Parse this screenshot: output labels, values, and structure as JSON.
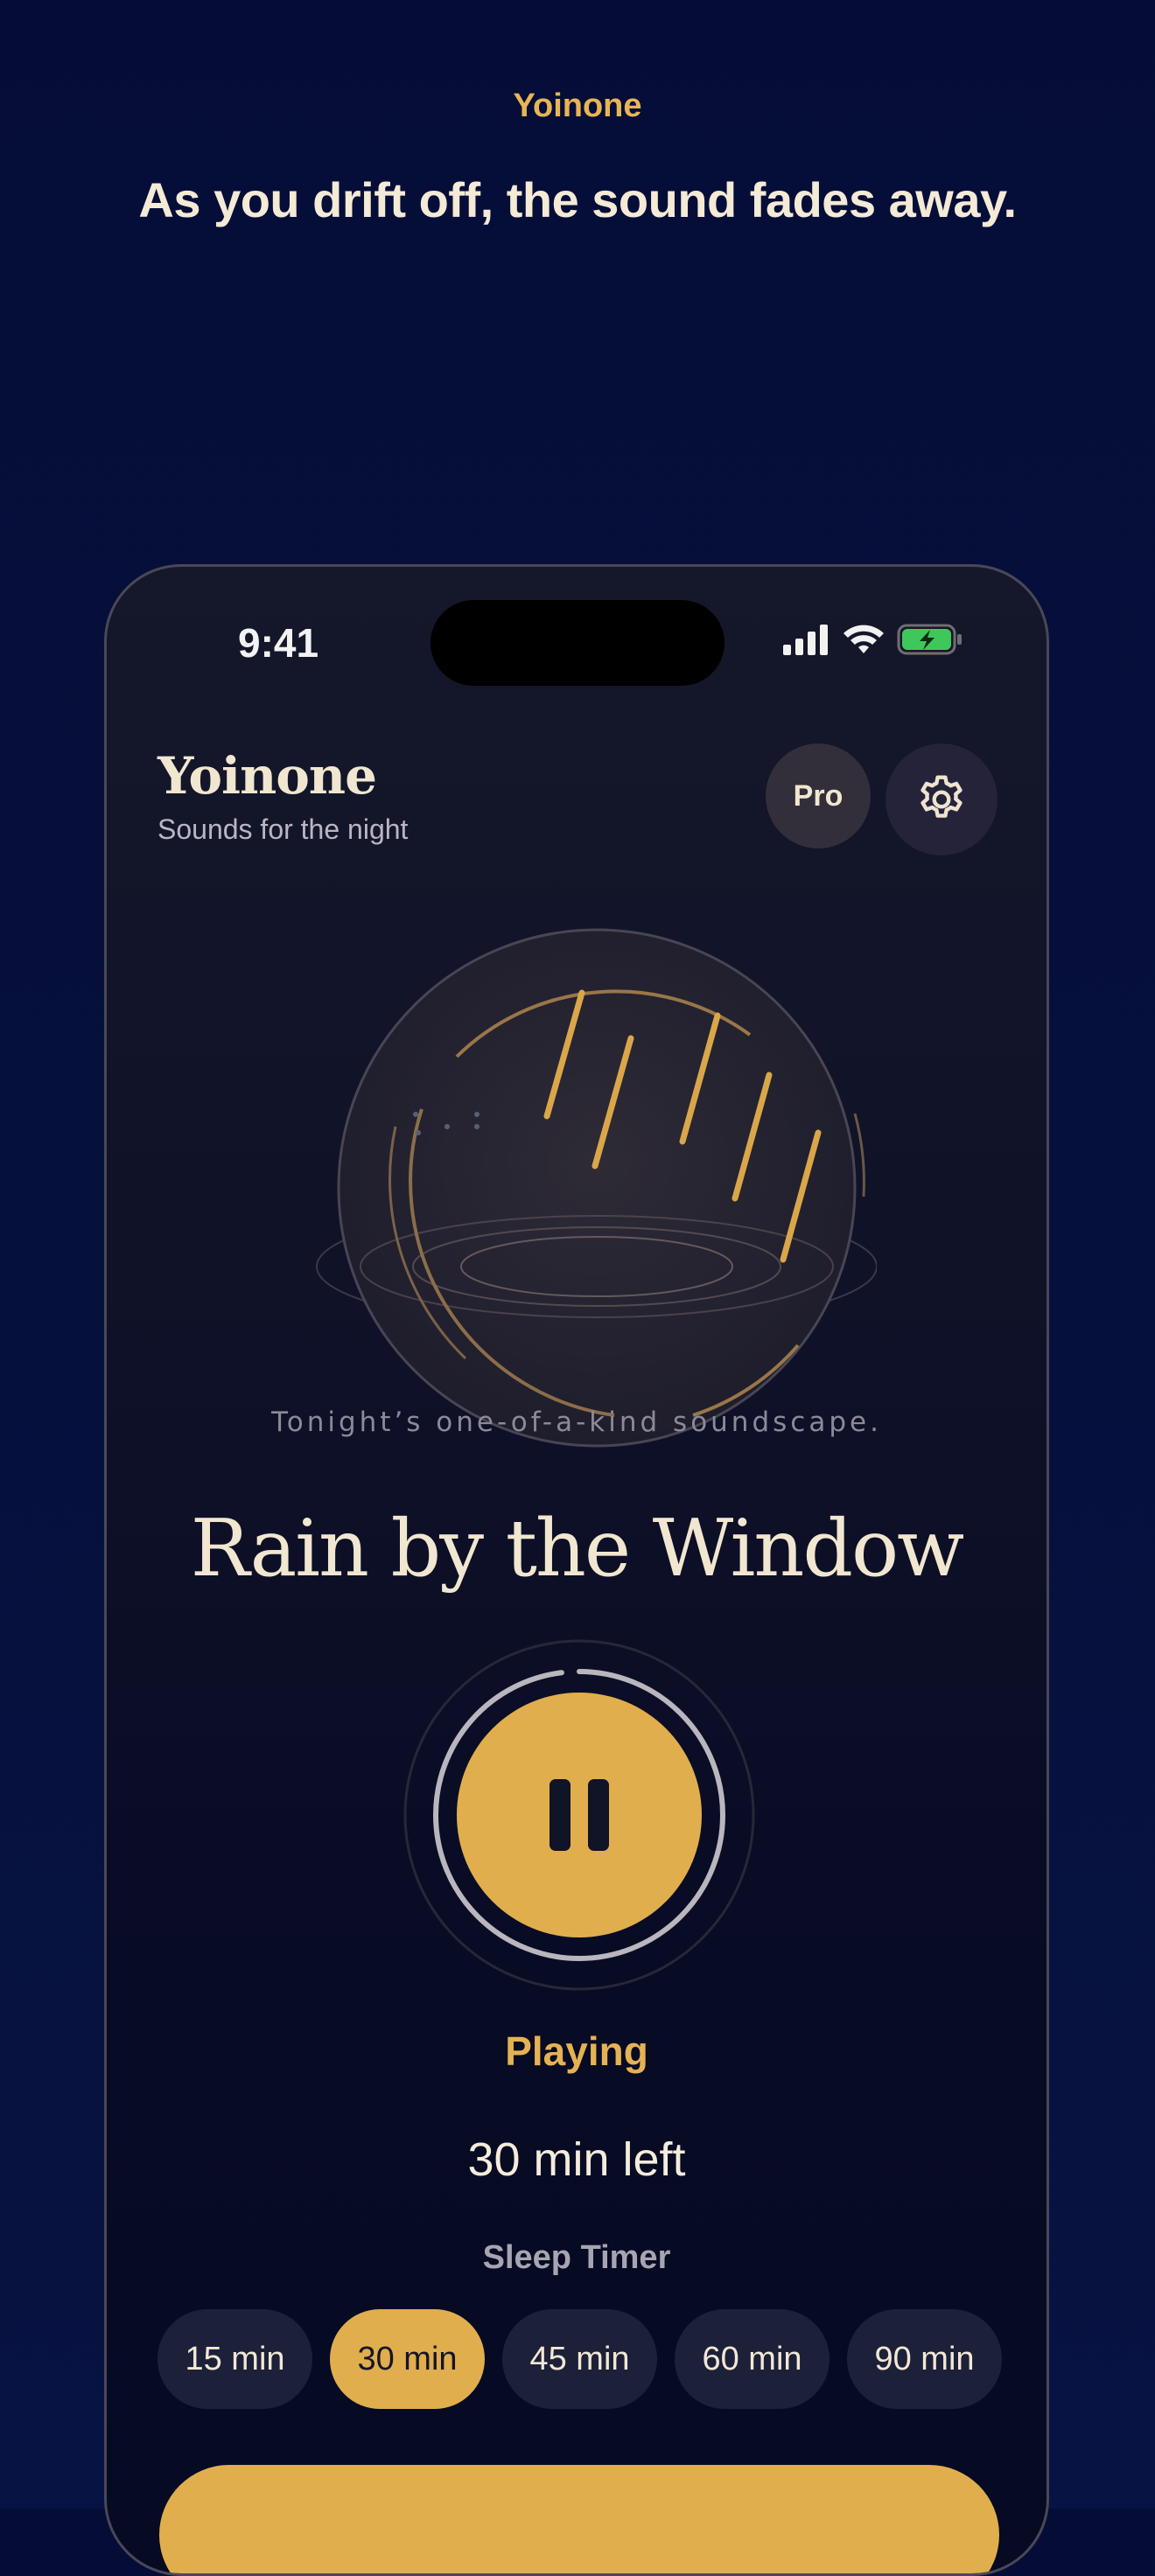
{
  "header": {
    "brand": "Yoinone",
    "headline": "As you drift off, the sound fades away."
  },
  "status_bar": {
    "time": "9:41",
    "icons": [
      "cellular-signal-icon",
      "wifi-icon",
      "battery-charging-icon"
    ]
  },
  "app": {
    "title": "Yoinone",
    "subtitle": "Sounds for the night",
    "pro_label": "Pro",
    "settings_icon": "gear-icon"
  },
  "soundscape": {
    "caption": "Tonight’s one-of-a-kind soundscape.",
    "title": "Rain by the Window",
    "art_icon": "rain-orb-illustration"
  },
  "player": {
    "button_icon": "pause-icon",
    "status": "Playing",
    "remaining": "30 min left",
    "progress_fraction": 0.98
  },
  "sleep_timer": {
    "label": "Sleep Timer",
    "options": [
      "15 min",
      "30 min",
      "45 min",
      "60 min",
      "90 min"
    ],
    "selected": "30 min"
  },
  "colors": {
    "background": "#070f38",
    "accent": "#e1ae4e",
    "text_light": "#f1e6cf",
    "muted": "#a7a5b1",
    "chip": "#1d2039"
  }
}
